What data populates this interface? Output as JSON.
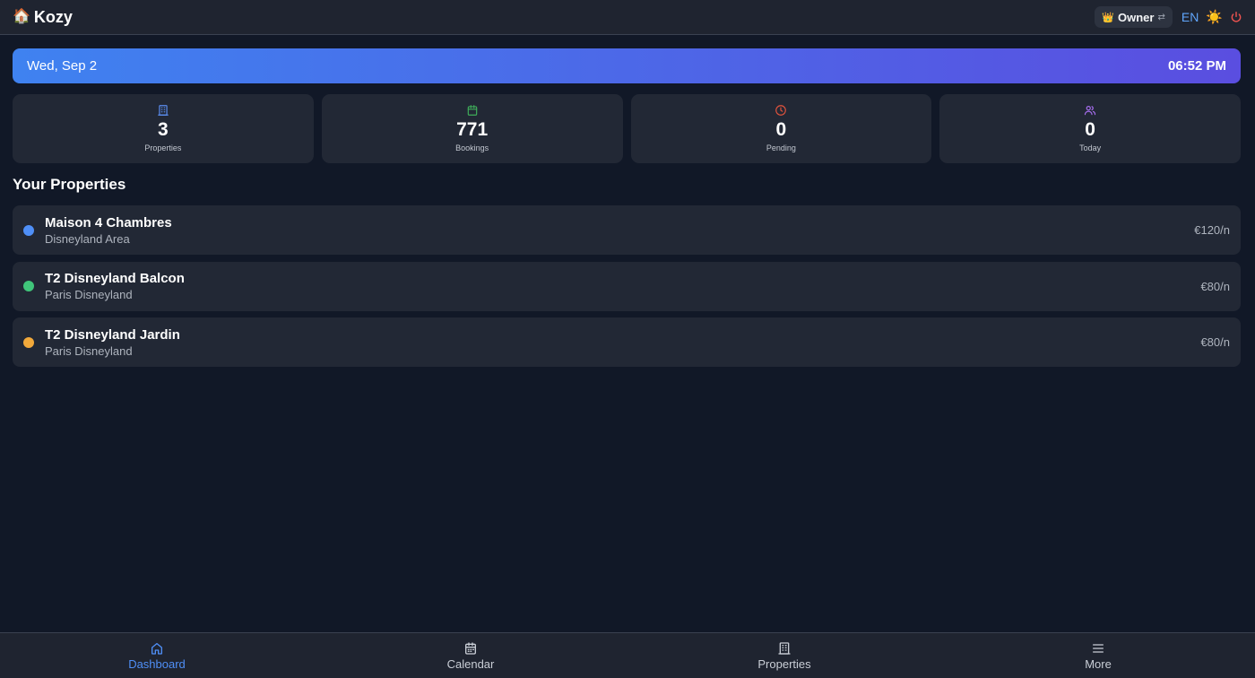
{
  "header": {
    "brand_icon": "🏠",
    "brand_name": "Kozy",
    "role_icon": "👑",
    "role_label": "Owner",
    "role_switch_icon": "⇄",
    "language": "EN",
    "theme_icon": "☀️"
  },
  "banner": {
    "date": "Wed, Sep 2",
    "time": "06:52 PM"
  },
  "stats": [
    {
      "value": "3",
      "label": "Properties",
      "icon": "building-icon",
      "color": "#5b8def"
    },
    {
      "value": "771",
      "label": "Bookings",
      "icon": "calendar-icon",
      "color": "#3fae5a"
    },
    {
      "value": "0",
      "label": "Pending",
      "icon": "clock-icon",
      "color": "#e0533d"
    },
    {
      "value": "0",
      "label": "Today",
      "icon": "users-icon",
      "color": "#a86ff0"
    }
  ],
  "section_title": "Your Properties",
  "properties": [
    {
      "name": "Maison 4 Chambres",
      "location": "Disneyland Area",
      "price": "€120/n",
      "color": "#4f8ff7"
    },
    {
      "name": "T2 Disneyland Balcon",
      "location": "Paris Disneyland",
      "price": "€80/n",
      "color": "#40c57a"
    },
    {
      "name": "T2 Disneyland Jardin",
      "location": "Paris Disneyland",
      "price": "€80/n",
      "color": "#f2a93b"
    }
  ],
  "nav": [
    {
      "label": "Dashboard",
      "icon": "home-icon",
      "active": true
    },
    {
      "label": "Calendar",
      "icon": "calendar-icon",
      "active": false
    },
    {
      "label": "Properties",
      "icon": "building-icon",
      "active": false
    },
    {
      "label": "More",
      "icon": "menu-icon",
      "active": false
    }
  ],
  "colors": {
    "background": "#111827",
    "card": "#222835",
    "accent": "#4f8ff7",
    "banner_start": "#3f82f0",
    "banner_end": "#5a4ee0"
  }
}
